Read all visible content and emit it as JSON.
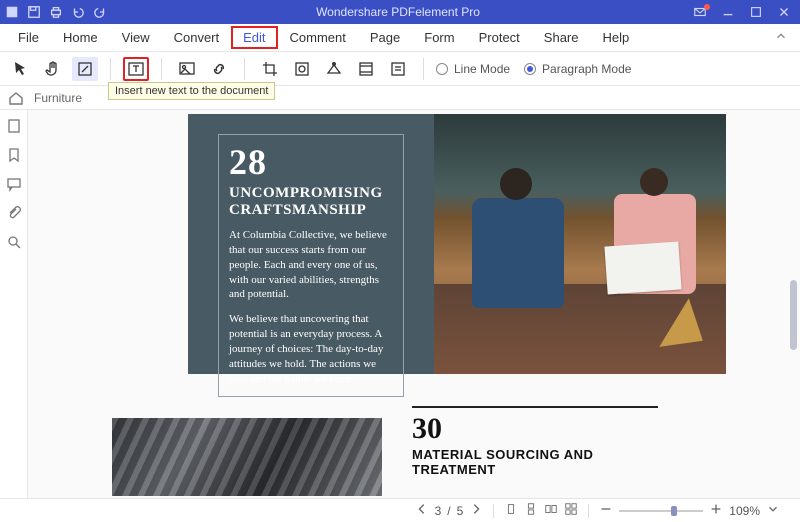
{
  "window": {
    "title": "Wondershare PDFelement Pro"
  },
  "menu": {
    "items": [
      "File",
      "Home",
      "View",
      "Convert",
      "Edit",
      "Comment",
      "Page",
      "Form",
      "Protect",
      "Share",
      "Help"
    ],
    "active_index": 4
  },
  "toolbar": {
    "tooltip": "Insert new text to the document",
    "radio": {
      "line": "Line Mode",
      "paragraph": "Paragraph Mode",
      "selected": "paragraph"
    },
    "icons": {
      "cursor": "cursor",
      "hand": "hand",
      "select-box": "select-box",
      "add-text": "add-text",
      "image": "image",
      "link": "link",
      "crop": "crop",
      "watermark-image": "watermark-image",
      "background": "background",
      "header-footer": "header-footer",
      "bates": "bates"
    }
  },
  "breadcrumb": {
    "label": "Furniture"
  },
  "sidebar": {
    "items": [
      "thumbnails",
      "bookmarks",
      "annotations",
      "attachments",
      "search"
    ]
  },
  "document": {
    "block1": {
      "number": "28",
      "heading": "UNCOMPROMISING CRAFTSMANSHIP",
      "p1": "At Columbia Collective, we believe that our success starts from our people. Each and every one of us, with our varied abilities, strengths and potential.",
      "p2": "We believe that uncovering that potential is an everyday process. A journey of choices: The day-to-day attitudes we hold. The actions we take and the habits we form."
    },
    "block2": {
      "number": "30",
      "heading": "MATERIAL SOURCING AND TREATMENT"
    }
  },
  "statusbar": {
    "page_current": "3",
    "page_total": "5",
    "zoom": "109%"
  }
}
